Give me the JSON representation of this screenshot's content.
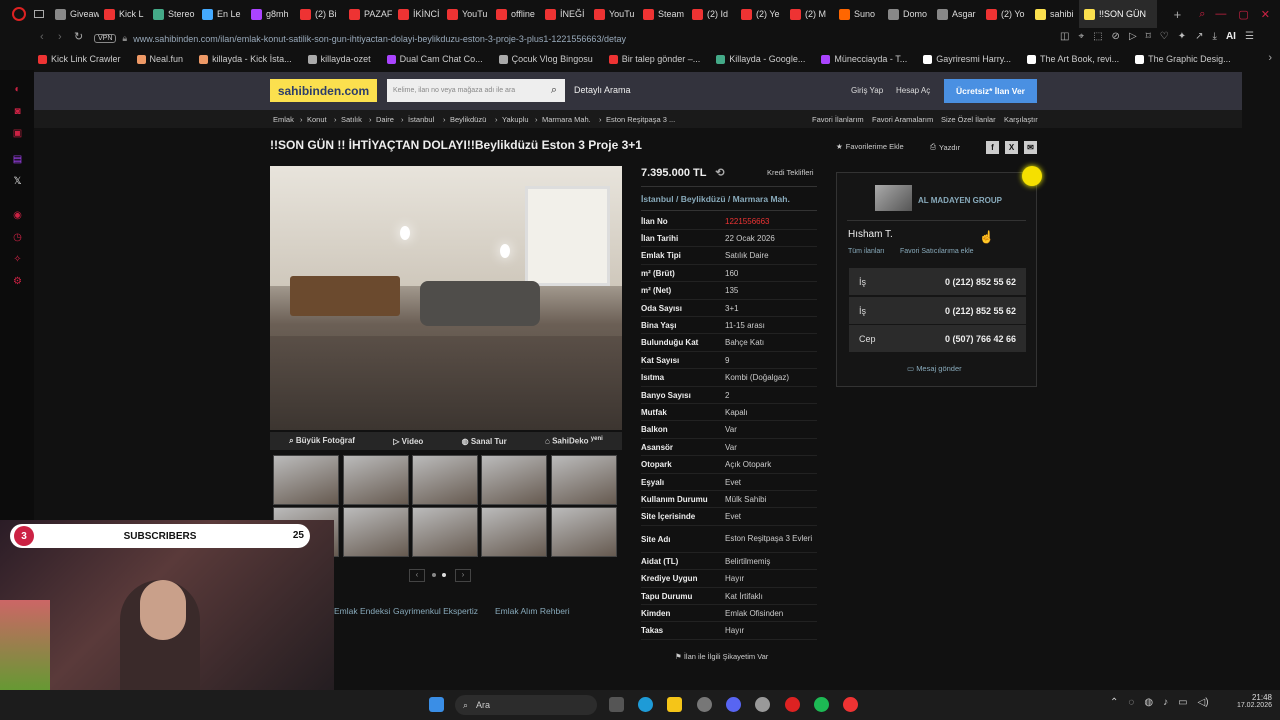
{
  "browser": {
    "tabs": [
      {
        "label": "Giveaw",
        "color": "#888"
      },
      {
        "label": "Kick L",
        "color": "#e33"
      },
      {
        "label": "Stereo",
        "color": "#4a8"
      },
      {
        "label": "En Le",
        "color": "#4af"
      },
      {
        "label": "g8mh",
        "color": "#a4f"
      },
      {
        "label": "(2) Bi",
        "color": "#e33"
      },
      {
        "label": "PAZAF",
        "color": "#e33"
      },
      {
        "label": "İKİNCİ",
        "color": "#e33"
      },
      {
        "label": "YouTu",
        "color": "#e33"
      },
      {
        "label": "offline",
        "color": "#e33"
      },
      {
        "label": "İNEĞİ",
        "color": "#e33"
      },
      {
        "label": "YouTu",
        "color": "#e33"
      },
      {
        "label": "Steam",
        "color": "#e33"
      },
      {
        "label": "(2) Id",
        "color": "#e33"
      },
      {
        "label": "(2) Ye",
        "color": "#e33"
      },
      {
        "label": "(2) M",
        "color": "#e33"
      },
      {
        "label": "Suno",
        "color": "#f60"
      },
      {
        "label": "Domo",
        "color": "#888"
      },
      {
        "label": "Asgar",
        "color": "#888"
      },
      {
        "label": "(2) Yo",
        "color": "#e33"
      },
      {
        "label": "sahibi",
        "color": "#fbe04e"
      },
      {
        "label": "!!SON GÜN",
        "color": "#fbe04e"
      }
    ],
    "vpn": "VPN",
    "url": "www.sahibinden.com/ilan/emlak-konut-satilik-son-gun-ihtiyactan-dolayi-beylikduzu-eston-3-proje-3-plus1-1221556663/detay",
    "ai_label": "AI",
    "bookmarks": [
      {
        "label": "Kick Link Crawler",
        "color": "#e33"
      },
      {
        "label": "Neal.fun",
        "color": "#e96"
      },
      {
        "label": "killayda - Kick İsta...",
        "color": "#e96"
      },
      {
        "label": "killayda-ozet",
        "color": "#aaa"
      },
      {
        "label": "Dual Cam Chat Co...",
        "color": "#a4f"
      },
      {
        "label": "Çocuk Vlog Bingosu",
        "color": "#aaa"
      },
      {
        "label": "Bir talep gönder –...",
        "color": "#e33"
      },
      {
        "label": "Killayda - Google...",
        "color": "#4a8"
      },
      {
        "label": "Münecciayda - T...",
        "color": "#a4f"
      },
      {
        "label": "Gayriresmi Harry...",
        "color": "#fff"
      },
      {
        "label": "The Art Book, revi...",
        "color": "#fff"
      },
      {
        "label": "The Graphic Desig...",
        "color": "#fff"
      }
    ]
  },
  "site": {
    "logo": "sahibinden.com",
    "search_placeholder": "Kelime, ilan no veya mağaza adı ile ara",
    "detail_search": "Detaylı Arama",
    "login": "Giriş Yap",
    "register": "Hesap Aç",
    "post_ad": "Ücretsiz* İlan Ver",
    "breadcrumbs": [
      "Emlak",
      "Konut",
      "Satılık",
      "Daire",
      "İstanbul",
      "Beylikdüzü",
      "Yakuplu",
      "Marmara Mah.",
      "Eston Reşitpaşa 3 ..."
    ],
    "right_links": [
      "Favori İlanlarım",
      "Favori Aramalarım",
      "Size Özel İlanlar",
      "Karşılaştır"
    ],
    "title": "!!SON GÜN !! İHTİYAÇTAN DOLAYI!!Beylikdüzü Eston 3 Proje 3+1",
    "favorite": "Favorilerime Ekle",
    "print": "Yazdır",
    "photo_tabs": [
      "Büyük Fotoğraf",
      "Video",
      "Sanal Tur",
      "SahiDeko"
    ],
    "new_badge": "yeni",
    "bottom_links": [
      "Emlak Endeksi",
      "Gayrimenkul Ekspertiz",
      "Emlak Alım Rehberi"
    ]
  },
  "listing": {
    "price": "7.395.000 TL",
    "credit": "Kredi Teklifleri",
    "location": [
      "İstanbul",
      "Beylikdüzü",
      "Marmara Mah."
    ],
    "specs": [
      {
        "k": "İlan No",
        "v": "1221556663",
        "red": true
      },
      {
        "k": "İlan Tarihi",
        "v": "22 Ocak 2026"
      },
      {
        "k": "Emlak Tipi",
        "v": "Satılık Daire"
      },
      {
        "k": "m² (Brüt)",
        "v": "160"
      },
      {
        "k": "m² (Net)",
        "v": "135"
      },
      {
        "k": "Oda Sayısı",
        "v": "3+1"
      },
      {
        "k": "Bina Yaşı",
        "v": "11-15 arası"
      },
      {
        "k": "Bulunduğu Kat",
        "v": "Bahçe Katı"
      },
      {
        "k": "Kat Sayısı",
        "v": "9"
      },
      {
        "k": "Isıtma",
        "v": "Kombi (Doğalgaz)"
      },
      {
        "k": "Banyo Sayısı",
        "v": "2"
      },
      {
        "k": "Mutfak",
        "v": "Kapalı"
      },
      {
        "k": "Balkon",
        "v": "Var"
      },
      {
        "k": "Asansör",
        "v": "Var"
      },
      {
        "k": "Otopark",
        "v": "Açık Otopark"
      },
      {
        "k": "Eşyalı",
        "v": "Evet"
      },
      {
        "k": "Kullanım Durumu",
        "v": "Mülk Sahibi"
      },
      {
        "k": "Site İçerisinde",
        "v": "Evet"
      },
      {
        "k": "Site Adı",
        "v": "Eston Reşitpaşa 3 Evleri"
      },
      {
        "k": "Aidat (TL)",
        "v": "Belirtilmemiş"
      },
      {
        "k": "Krediye Uygun",
        "v": "Hayır"
      },
      {
        "k": "Tapu Durumu",
        "v": "Kat İrtifaklı"
      },
      {
        "k": "Kimden",
        "v": "Emlak Ofisinden"
      },
      {
        "k": "Takas",
        "v": "Hayır"
      }
    ],
    "complaint": "İlan ile İlgili Şikayetim Var"
  },
  "seller": {
    "company": "AL MADAYEN GROUP",
    "name": "Hısham T.",
    "all_ads": "Tüm ilanları",
    "fav_seller": "Favori Satıcılarıma ekle",
    "phones": [
      {
        "type": "İş",
        "num": "0 (212) 852 55 62"
      },
      {
        "type": "İş",
        "num": "0 (212) 852 55 62"
      },
      {
        "type": "Cep",
        "num": "0 (507) 766 42 66"
      }
    ],
    "message": "Mesaj gönder"
  },
  "overlay": {
    "subs_left": "3",
    "subs_label": "SUBSCRIBERS",
    "subs_right": "25"
  },
  "taskbar": {
    "search": "Ara",
    "time": "21:48",
    "date": "17.02.2026"
  }
}
